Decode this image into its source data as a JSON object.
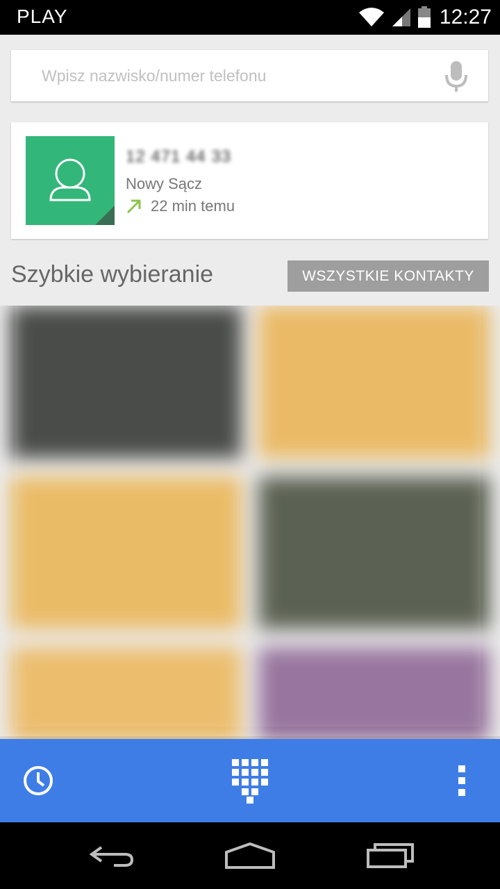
{
  "status_bar": {
    "carrier": "PLAY",
    "time": "12:27",
    "icons": [
      "wifi-icon",
      "signal-icon",
      "battery-icon"
    ]
  },
  "search": {
    "placeholder": "Wpisz nazwisko/numer telefonu",
    "value": "",
    "mic_icon": "microphone-icon"
  },
  "recent_call": {
    "number": "12 471 44 33",
    "location": "Nowy Sącz",
    "time_ago": "22 min temu",
    "call_type_icon": "outgoing-call-arrow-icon",
    "avatar_color": "#33b679"
  },
  "speed_dial": {
    "title": "Szybkie wybieranie",
    "all_contacts_label": "WSZYSTKIE KONTAKTY",
    "tiles": [
      {
        "color": "#3a3d3a"
      },
      {
        "color": "#e9b55a"
      },
      {
        "color": "#e9b65a"
      },
      {
        "color": "#4f5545"
      },
      {
        "color": "#eab861"
      },
      {
        "color": "#8f6a96"
      }
    ]
  },
  "action_bar": {
    "color": "#3f7de6",
    "buttons": [
      {
        "icon": "history-clock-icon"
      },
      {
        "icon": "dialpad-icon"
      },
      {
        "icon": "overflow-menu-icon"
      }
    ]
  },
  "nav_bar": {
    "buttons": [
      {
        "icon": "back-icon"
      },
      {
        "icon": "home-icon"
      },
      {
        "icon": "recent-apps-icon"
      }
    ]
  }
}
